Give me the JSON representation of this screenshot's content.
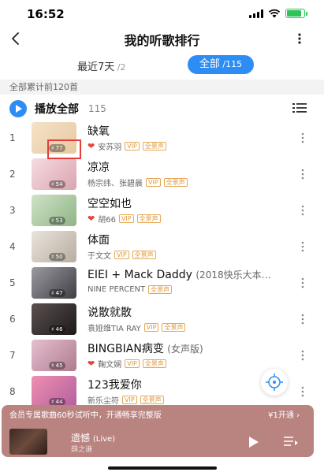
{
  "status_bar": {
    "time": "16:52",
    "battery_level": 0.85
  },
  "header": {
    "title": "我的听歌排行"
  },
  "tabs": [
    {
      "label": "最近7天",
      "count": " /2",
      "selected": false
    },
    {
      "label": "全部",
      "count": " /115",
      "selected": true
    }
  ],
  "total_text": "全部累计前120首",
  "play_all": {
    "label": "播放全部",
    "count": "115"
  },
  "songs": [
    {
      "rank": "1",
      "title": "缺氧",
      "title_sub": "",
      "artist": "安苏羽",
      "liked": true,
      "tags": [
        "VIP",
        "全景声"
      ],
      "plays": "77",
      "cover": [
        "#f4e2c8",
        "#e8c9a0"
      ]
    },
    {
      "rank": "2",
      "title": "凉凉",
      "title_sub": "",
      "artist": "杨宗纬、张碧晨",
      "liked": false,
      "tags": [
        "VIP",
        "全景声"
      ],
      "plays": "54",
      "cover": [
        "#f7dbe1",
        "#d9a4b0"
      ]
    },
    {
      "rank": "3",
      "title": "空空如也",
      "title_sub": "",
      "artist": "胡66",
      "liked": true,
      "tags": [
        "VIP",
        "全景声"
      ],
      "plays": "53",
      "cover": [
        "#cfe3c6",
        "#8fb486"
      ]
    },
    {
      "rank": "4",
      "title": "体面",
      "title_sub": "",
      "artist": "于文文",
      "liked": false,
      "tags": [
        "VIP",
        "全景声"
      ],
      "plays": "50",
      "cover": [
        "#e9e4dc",
        "#b8ada0"
      ]
    },
    {
      "rank": "5",
      "title": "EIEI + Mack Daddy",
      "title_sub": "(2018快乐大本…",
      "artist": "NINE PERCENT",
      "liked": false,
      "tags": [
        "全景声"
      ],
      "plays": "47",
      "cover": [
        "#9a9aa0",
        "#3e3e44"
      ]
    },
    {
      "rank": "6",
      "title": "说散就散",
      "title_sub": "",
      "artist": "袁娅维TIA RAY",
      "liked": false,
      "tags": [
        "VIP",
        "全景声"
      ],
      "plays": "46",
      "cover": [
        "#5b5050",
        "#1e1a1a"
      ]
    },
    {
      "rank": "7",
      "title": "BINGBIAN病变",
      "title_sub": "(女声版)",
      "artist": "鞠文娴",
      "liked": true,
      "tags": [
        "VIP",
        "全景声"
      ],
      "plays": "45",
      "cover": [
        "#e4c0cf",
        "#b07a90"
      ]
    },
    {
      "rank": "8",
      "title": "123我爱你",
      "title_sub": "",
      "artist": "新乐尘符",
      "liked": false,
      "tags": [
        "VIP",
        "全景声"
      ],
      "plays": "44",
      "cover": [
        "#ef8fb0",
        "#b35fa0"
      ]
    }
  ],
  "vip_banner": {
    "text": "会员专属歌曲60秒试听中，开通畅享完整版",
    "action": "¥1开通 ›"
  },
  "player": {
    "title": "遗憾",
    "title_sub": "(Live)",
    "artist": "薛之谦"
  },
  "colors": {
    "accent": "#2d8df5",
    "player_bg": "#b98380",
    "like": "#e8423a",
    "tag": "#e09a3c"
  }
}
